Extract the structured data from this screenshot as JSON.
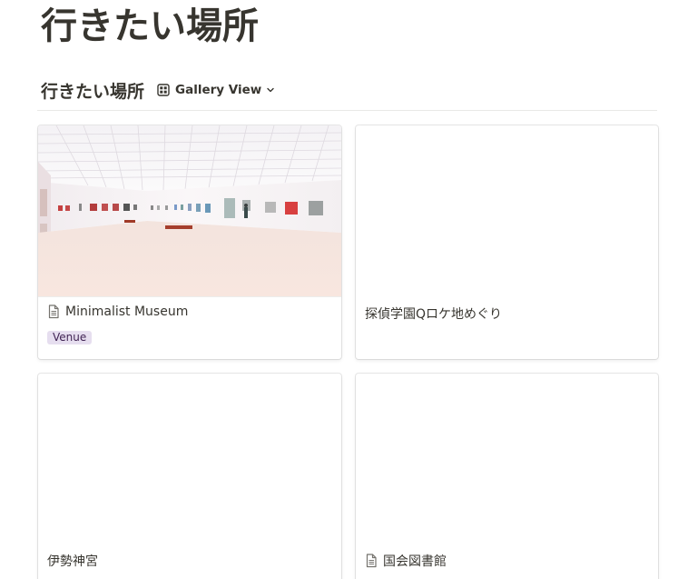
{
  "page": {
    "title": "行きたい場所"
  },
  "database": {
    "title": "行きたい場所",
    "view_label": "Gallery View",
    "view_icon": "gallery-grid-icon",
    "view_chevron_icon": "chevron-down-icon"
  },
  "cards": [
    {
      "title": "Minimalist Museum",
      "has_page_icon": true,
      "has_cover": true,
      "tag": "Venue",
      "tag_color": "#e6deef"
    },
    {
      "title": "探偵学園Qロケ地めぐり",
      "has_page_icon": false,
      "has_cover": false
    },
    {
      "title": "伊勢神宮",
      "has_page_icon": false,
      "has_cover": false
    },
    {
      "title": "国会図書館",
      "has_page_icon": true,
      "has_cover": false
    }
  ]
}
